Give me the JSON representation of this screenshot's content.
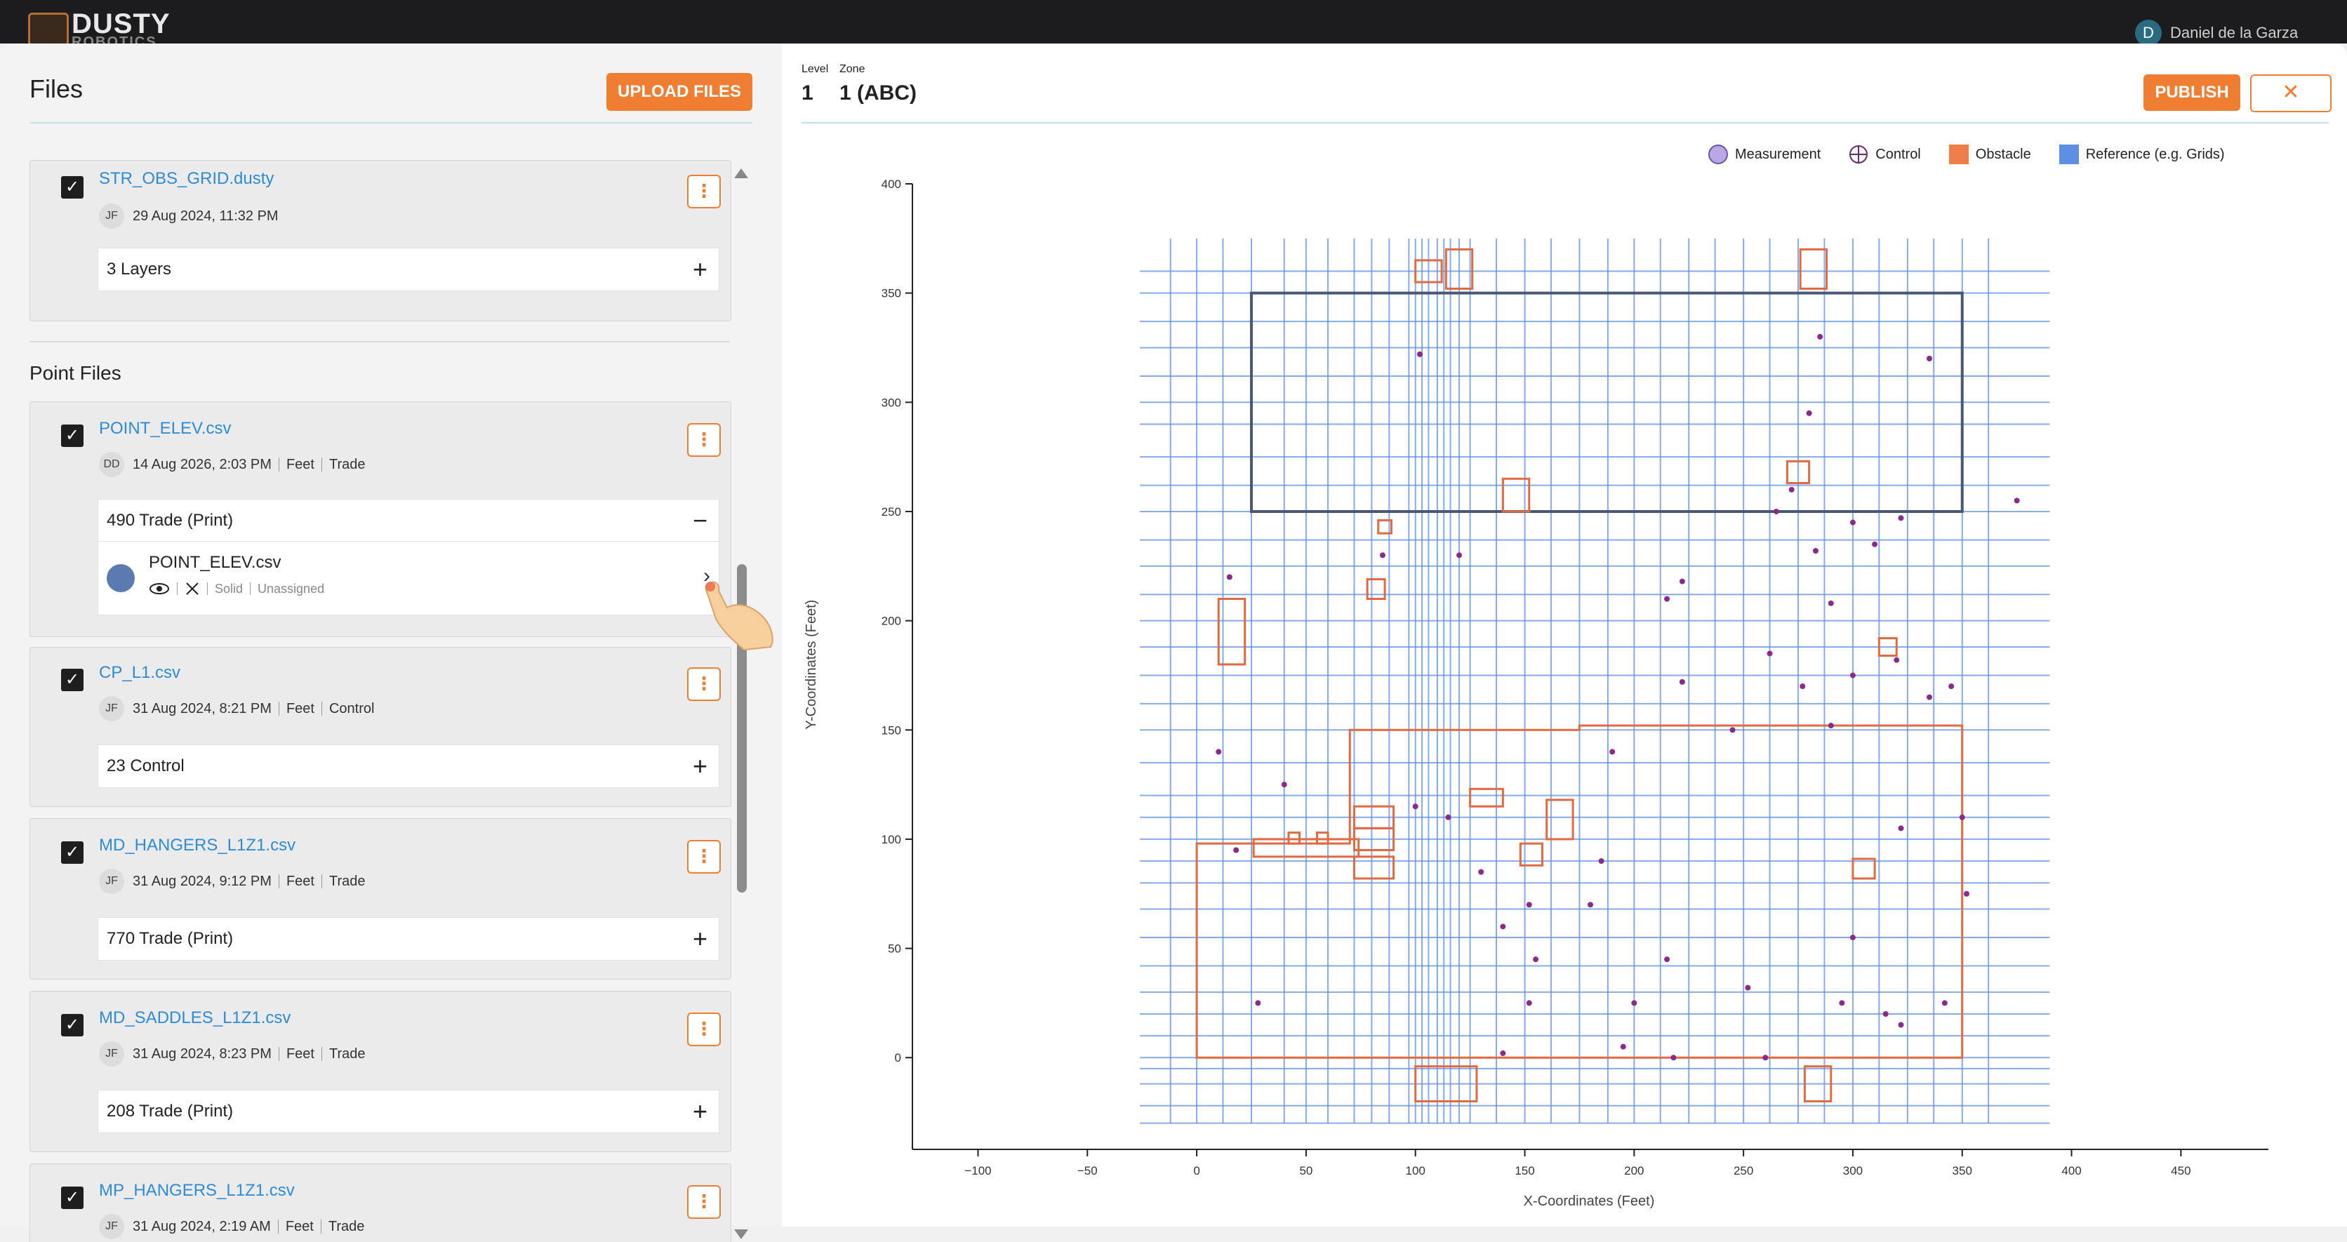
{
  "header": {
    "logo_text": "DUSTY",
    "logo_sub": "ROBOTICS",
    "user_initial": "D",
    "user_name": "Daniel de la Garza"
  },
  "files_panel": {
    "title": "Files",
    "upload_label": "UPLOAD FILES",
    "obstacle_file": {
      "name": "STR_OBS_GRID.dusty",
      "initials": "JF",
      "date": "29 Aug 2024, 11:32 PM",
      "layers_label": "3 Layers",
      "layers_icon": "+"
    },
    "point_files_title": "Point Files",
    "point_files": [
      {
        "name": "POINT_ELEV.csv",
        "initials": "DD",
        "date": "14 Aug 2026, 2:03 PM",
        "unit": "Feet",
        "type": "Trade",
        "layer_label": "490 Trade (Print)",
        "layer_icon": "−",
        "expanded": true,
        "sub": {
          "name": "POINT_ELEV.csv",
          "style": "Solid",
          "assignment": "Unassigned",
          "color": "#5a7ab0"
        }
      },
      {
        "name": "CP_L1.csv",
        "initials": "JF",
        "date": "31 Aug 2024, 8:21 PM",
        "unit": "Feet",
        "type": "Control",
        "layer_label": "23 Control",
        "layer_icon": "+"
      },
      {
        "name": "MD_HANGERS_L1Z1.csv",
        "initials": "JF",
        "date": "31 Aug 2024, 9:12 PM",
        "unit": "Feet",
        "type": "Trade",
        "layer_label": "770 Trade (Print)",
        "layer_icon": "+"
      },
      {
        "name": "MD_SADDLES_L1Z1.csv",
        "initials": "JF",
        "date": "31 Aug 2024, 8:23 PM",
        "unit": "Feet",
        "type": "Trade",
        "layer_label": "208 Trade (Print)",
        "layer_icon": "+"
      },
      {
        "name": "MP_HANGERS_L1Z1.csv",
        "initials": "JF",
        "date": "31 Aug 2024, 2:19 AM",
        "unit": "Feet",
        "type": "Trade"
      }
    ]
  },
  "viewer": {
    "level_label": "Level",
    "zone_label": "Zone",
    "level_value": "1",
    "zone_value": "1 (ABC)",
    "publish_label": "PUBLISH",
    "close_icon": "✕",
    "legend": [
      {
        "label": "Measurement",
        "icon": "measurement-icon",
        "color": "#b9a7e8"
      },
      {
        "label": "Control",
        "icon": "control-icon",
        "color": "#6d2a6e"
      },
      {
        "label": "Obstacle",
        "icon": "obstacle-icon",
        "color": "#ef7e48"
      },
      {
        "label": "Reference (e.g. Grids)",
        "icon": "reference-icon",
        "color": "#5e8fe3"
      }
    ]
  },
  "chart_data": {
    "type": "scatter",
    "xlabel": "X-Coordinates (Feet)",
    "ylabel": "Y-Coordinates (Feet)",
    "xlim": [
      -130,
      490
    ],
    "ylim": [
      -42,
      400
    ],
    "x_ticks": [
      -100,
      -50,
      0,
      50,
      100,
      150,
      200,
      250,
      300,
      350,
      400,
      450
    ],
    "y_ticks": [
      0,
      50,
      100,
      150,
      200,
      250,
      300,
      350,
      400
    ],
    "reference_v": [
      -12,
      0,
      12,
      25,
      40,
      50,
      60,
      72,
      80,
      88,
      97,
      100,
      103,
      106,
      110,
      113,
      116,
      120,
      125,
      137,
      150,
      162,
      175,
      188,
      200,
      212,
      225,
      237,
      250,
      262,
      275,
      287,
      300,
      312,
      325,
      337,
      350,
      362
    ],
    "reference_h": [
      -30,
      -22,
      -12,
      -5,
      0,
      10,
      20,
      30,
      42,
      55,
      68,
      80,
      90,
      100,
      110,
      120,
      135,
      150,
      162,
      175,
      188,
      200,
      212,
      225,
      237,
      250,
      262,
      275,
      290,
      300,
      312,
      325,
      337,
      350,
      360
    ],
    "building_outline": [
      [
        25,
        350
      ],
      [
        350,
        350
      ],
      [
        350,
        250
      ],
      [
        25,
        250
      ]
    ],
    "obstacle_outline": [
      [
        0,
        98
      ],
      [
        70,
        98
      ],
      [
        70,
        150
      ],
      [
        175,
        150
      ],
      [
        175,
        152
      ],
      [
        350,
        152
      ],
      [
        350,
        0
      ],
      [
        0,
        0
      ]
    ],
    "obstacle_rects": [
      [
        10,
        180,
        12,
        30
      ],
      [
        78,
        210,
        8,
        9
      ],
      [
        72,
        105,
        18,
        10
      ],
      [
        72,
        95,
        18,
        10
      ],
      [
        72,
        82,
        18,
        10
      ],
      [
        26,
        92,
        48,
        8
      ],
      [
        42,
        98,
        5,
        5
      ],
      [
        55,
        98,
        5,
        5
      ],
      [
        125,
        115,
        15,
        8
      ],
      [
        148,
        88,
        10,
        10
      ],
      [
        160,
        100,
        12,
        18
      ],
      [
        300,
        82,
        10,
        9
      ],
      [
        312,
        184,
        8,
        8
      ],
      [
        100,
        -20,
        28,
        16
      ],
      [
        278,
        -20,
        12,
        16
      ],
      [
        100,
        355,
        12,
        10
      ],
      [
        114,
        352,
        12,
        18
      ],
      [
        276,
        352,
        12,
        18
      ],
      [
        83,
        240,
        6,
        6
      ],
      [
        140,
        250,
        12,
        15
      ],
      [
        270,
        263,
        10,
        10
      ]
    ],
    "control_points": [
      [
        15,
        220
      ],
      [
        85,
        230
      ],
      [
        102,
        322
      ],
      [
        120,
        230
      ],
      [
        265,
        250
      ],
      [
        215,
        210
      ],
      [
        262,
        185
      ],
      [
        277,
        170
      ],
      [
        290,
        208
      ],
      [
        300,
        245
      ],
      [
        283,
        232
      ],
      [
        272,
        260
      ],
      [
        280,
        295
      ],
      [
        285,
        330
      ],
      [
        310,
        235
      ],
      [
        322,
        247
      ],
      [
        335,
        320
      ],
      [
        375,
        255
      ],
      [
        222,
        218
      ],
      [
        190,
        140
      ],
      [
        222,
        172
      ],
      [
        245,
        150
      ],
      [
        290,
        152
      ],
      [
        300,
        175
      ],
      [
        320,
        182
      ],
      [
        335,
        165
      ],
      [
        345,
        170
      ],
      [
        350,
        110
      ],
      [
        322,
        105
      ],
      [
        352,
        75
      ],
      [
        300,
        55
      ],
      [
        215,
        45
      ],
      [
        140,
        60
      ],
      [
        180,
        70
      ],
      [
        200,
        25
      ],
      [
        152,
        25
      ],
      [
        252,
        32
      ],
      [
        295,
        25
      ],
      [
        315,
        20
      ],
      [
        322,
        15
      ],
      [
        342,
        25
      ],
      [
        260,
        0
      ],
      [
        218,
        0
      ],
      [
        195,
        5
      ],
      [
        140,
        2
      ],
      [
        28,
        25
      ],
      [
        152,
        70
      ],
      [
        10,
        140
      ],
      [
        40,
        125
      ],
      [
        18,
        95
      ],
      [
        100,
        115
      ],
      [
        115,
        110
      ],
      [
        130,
        85
      ],
      [
        155,
        45
      ],
      [
        185,
        90
      ]
    ]
  }
}
